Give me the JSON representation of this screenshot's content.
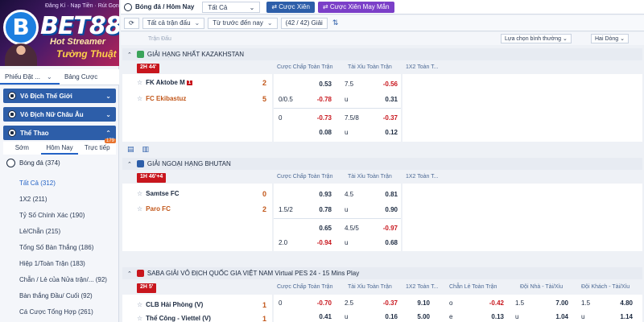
{
  "banner": {
    "top_text": "Đăng Kí · Nạp Tiền · Rút Gọn",
    "logo_letter": "B",
    "logo_text": "BET88",
    "title1": "Hot Streamer",
    "title2": "Tường Thuật"
  },
  "slip": {
    "tab1": "Phiếu Đặt ...",
    "tab2": "Bảng Cược"
  },
  "categories": [
    {
      "label": "Vô Địch Thế Giới"
    },
    {
      "label": "Vô Địch Nữ Châu Âu"
    },
    {
      "label": "Thể Thao"
    }
  ],
  "time_tabs": {
    "early": "Sớm",
    "today": "Hôm Nay",
    "live": "Trực tiếp",
    "live_count": "179"
  },
  "sport": {
    "label": "Bóng đá",
    "count": "(374)"
  },
  "sub_items": [
    "Tất Cả (312)",
    "1X2 (211)",
    "Tỷ Số Chính Xác (190)",
    "Lẻ/Chẵn (215)",
    "Tổng Số Bàn Thắng (186)",
    "Hiệp 1/Toàn Trận (183)",
    "Chẵn / Lẻ của Nửa trận/... (92)",
    "Bàn thắng Đầu/ Cuối (92)",
    "Cá Cược Tổng Hợp (261)"
  ],
  "topbar": {
    "title": "Bóng đá / Hôm Nay",
    "select": "Tất Cả",
    "btn_xien": "Cược Xiên",
    "btn_xien_may": "Cược Xiên May Mắn"
  },
  "filters": {
    "market": "Tất cả trận đấu",
    "sort": "Từ trước đến nay",
    "count": "(42 / 42) Giải"
  },
  "headbar": {
    "label": "Trận Đấu",
    "dd1": "Lựa chọn bình thường",
    "dd2": "Hai Dòng"
  },
  "colheads": {
    "handicap": "Cược Chấp Toàn Trận",
    "ou": "Tài Xỉu Toàn Trận",
    "x12": "1X2 Toàn T...",
    "oddeven": "Chẵn Lẻ Toàn Trận",
    "home_ou": "Đội Nhà - Tài/Xỉu",
    "away_ou": "Đội Khách - Tài/Xỉu"
  },
  "leagues": [
    {
      "name": "GIẢI HẠNG NHẤT KAZAKHSTAN",
      "time": "2H 44'",
      "home": "FK Aktobe M",
      "home_redcard": "1",
      "home_score": "2",
      "away": "FC Ekibastuz",
      "away_score": "5",
      "rows": [
        {
          "h_line": "",
          "h_odd": "0.53",
          "ou_line": "7.5",
          "ou_odd": "-0.56"
        },
        {
          "h_line": "0/0.5",
          "h_odd": "-0.78",
          "ou_line": "u",
          "ou_odd": "0.31"
        },
        {
          "h_line": "0",
          "h_odd": "-0.73",
          "ou_line": "7.5/8",
          "ou_odd": "-0.37"
        },
        {
          "h_line": "",
          "h_odd": "0.08",
          "ou_line": "u",
          "ou_odd": "0.12"
        }
      ]
    },
    {
      "name": "GIẢI NGOẠI HẠNG BHUTAN",
      "time": "1H 46'+4",
      "home": "Samtse FC",
      "home_score": "0",
      "away": "Paro FC",
      "away_score": "2",
      "rows": [
        {
          "h_line": "",
          "h_odd": "0.93",
          "ou_line": "4.5",
          "ou_odd": "0.81"
        },
        {
          "h_line": "1.5/2",
          "h_odd": "0.78",
          "ou_line": "u",
          "ou_odd": "0.90"
        },
        {
          "h_line": "",
          "h_odd": "0.65",
          "ou_line": "4.5/5",
          "ou_odd": "-0.97"
        },
        {
          "h_line": "2.0",
          "h_odd": "-0.94",
          "ou_line": "u",
          "ou_odd": "0.68"
        }
      ]
    },
    {
      "name": "SABA GIẢI VÔ ĐỊCH QUỐC GIA VIỆT NAM Virtual PES 24 - 15 Mins Play",
      "time": "2H 5'",
      "home": "CLB Hải Phòng (V)",
      "home_score": "1",
      "away": "Thể Công - Viettel (V)",
      "away_score": "1",
      "rows": [
        {
          "h_line": "0",
          "h_odd": "-0.70",
          "ou_line": "2.5",
          "ou_odd": "-0.37",
          "x12": "9.10",
          "oe_line": "o",
          "oe_odd": "-0.42",
          "hou_line": "1.5",
          "hou_odd": "7.00",
          "aou_line": "1.5",
          "aou_odd": "4.80"
        },
        {
          "h_line": "",
          "h_odd": "0.41",
          "ou_line": "u",
          "ou_odd": "0.16",
          "x12": "5.00",
          "oe_line": "e",
          "oe_odd": "0.13",
          "hou_line": "u",
          "hou_odd": "1.04",
          "aou_line": "u",
          "aou_odd": "1.14"
        }
      ]
    }
  ],
  "colors": {
    "primary": "#2d5ea9",
    "live_red": "#c8161d",
    "away_orange": "#c2571a",
    "purple": "#7b3fc8"
  }
}
